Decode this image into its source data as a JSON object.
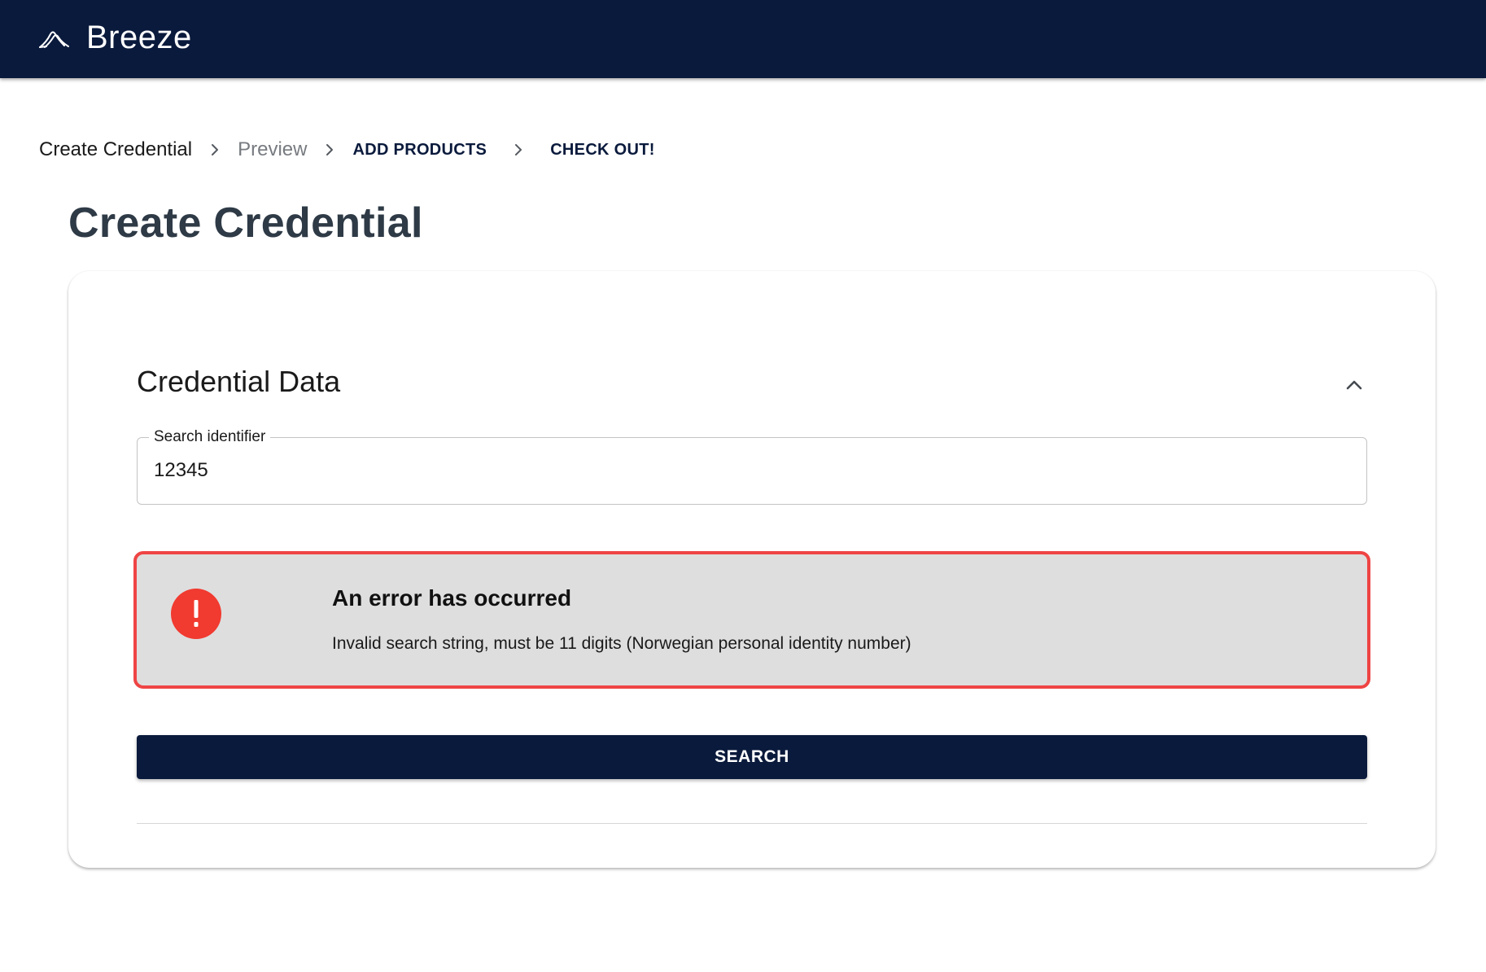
{
  "header": {
    "brand": "Breeze",
    "logo_icon": "breeze-wave-logo-icon",
    "background_color": "#0a1a3c"
  },
  "breadcrumb": {
    "items": [
      {
        "label": "Create Credential",
        "state": "current"
      },
      {
        "label": "Preview",
        "state": "muted"
      },
      {
        "label": "ADD PRODUCTS",
        "state": "upcoming"
      },
      {
        "label": "CHECK OUT!",
        "state": "upcoming"
      }
    ],
    "separator_icon": "chevron-right-icon"
  },
  "page": {
    "title": "Create Credential"
  },
  "credential_section": {
    "title": "Credential Data",
    "collapse_icon": "chevron-up-icon",
    "search_field": {
      "label": "Search identifier",
      "value": "12345"
    },
    "error": {
      "icon": "exclamation-icon",
      "title": "An error has occurred",
      "message": "Invalid search string, must be 11 digits (Norwegian personal identity number)",
      "border_color": "#ef4444",
      "icon_color": "#f13a30"
    },
    "search_button_label": "SEARCH"
  }
}
